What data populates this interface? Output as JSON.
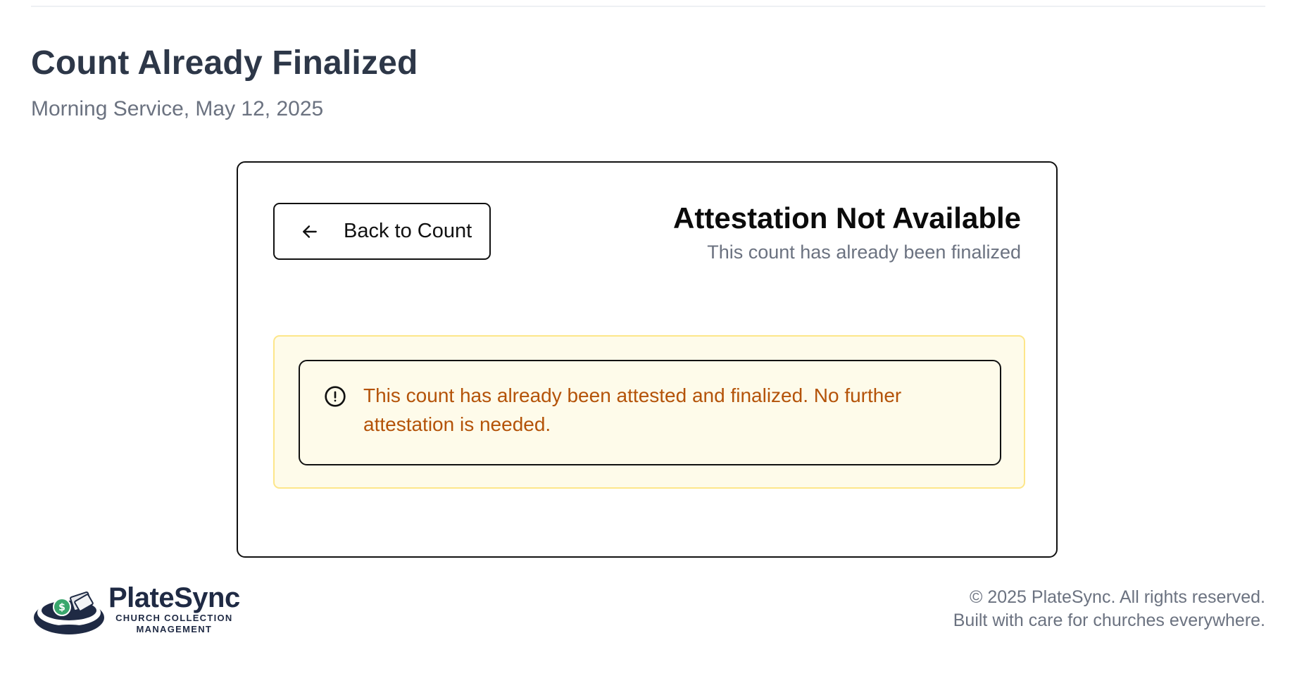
{
  "header": {
    "title": "Count Already Finalized",
    "subtitle": "Morning Service, May 12, 2025"
  },
  "card": {
    "back_button_label": "Back to Count",
    "status_heading": "Attestation Not Available",
    "status_subheading": "This count has already been finalized",
    "alert_message": "This count has already been attested and finalized. No further attestation is needed."
  },
  "footer": {
    "logo": {
      "name": "PlateSync",
      "tagline_line1": "CHURCH COLLECTION",
      "tagline_line2": "MANAGEMENT"
    },
    "copyright": "© 2025 PlateSync. All rights reserved.",
    "tagline": "Built with care for churches everywhere."
  },
  "icons": {
    "back": "arrow-left-icon",
    "alert": "alert-circle-icon",
    "logo": "collection-plate-icon"
  },
  "colors": {
    "title": "#2d3748",
    "muted": "#6b7280",
    "alert_text": "#b45309",
    "notice_bg": "#fefbea",
    "notice_border": "#fde68a",
    "brand": "#1f2a44",
    "brand_accent": "#3aa76d"
  }
}
